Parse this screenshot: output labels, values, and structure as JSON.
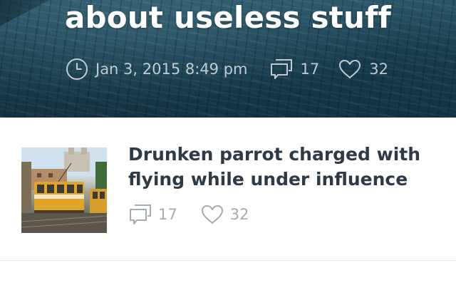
{
  "hero": {
    "title": "about useless stuff",
    "date": "Jan 3, 2015 8:49 pm",
    "comments": "17",
    "likes": "32",
    "icons": {
      "clock": "clock-icon",
      "comments": "comments-icon",
      "likes": "heart-icon"
    }
  },
  "article": {
    "title": "Drunken parrot charged with flying while under influence",
    "comments": "17",
    "likes": "32",
    "icons": {
      "comments": "comments-icon",
      "likes": "heart-icon"
    }
  },
  "colors": {
    "title_dark": "#2e3a45",
    "meta_gray": "#a4acb3",
    "hero_text": "#ffffff"
  }
}
